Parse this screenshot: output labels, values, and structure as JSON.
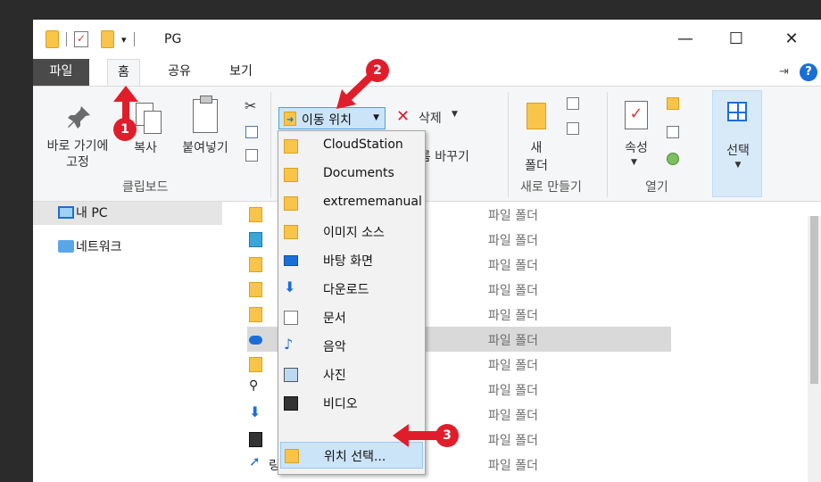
{
  "window": {
    "title": "PG"
  },
  "tabs": {
    "file": "파일",
    "home": "홈",
    "share": "공유",
    "view": "보기"
  },
  "ribbon": {
    "pin_label": "바로 가기에\n고정",
    "copy_label": "복사",
    "paste_label": "붙여넣기",
    "clipboard_group": "클립보드",
    "move_to_label": "이동 위치",
    "delete_label": "삭제",
    "rename_label": "이름 바꾸기",
    "new_folder_label_1": "새",
    "new_folder_label_2": "폴더",
    "new_group": "새로 만들기",
    "properties_label": "속성",
    "open_group": "열기",
    "select_label": "선택"
  },
  "nav": {
    "items": [
      "내 PC",
      "네트워크"
    ]
  },
  "dropdown": {
    "items": [
      "CloudStation",
      "Documents",
      "extrememanual",
      "이미지 소스",
      "바탕 화면",
      "다운로드",
      "문서",
      "음악",
      "사진",
      "비디오"
    ],
    "choose_location": "위치 선택..."
  },
  "file_list": {
    "rows": [
      {
        "name": "",
        "type": "파일 폴더"
      },
      {
        "name": "",
        "type": "파일 폴더"
      },
      {
        "name": "",
        "type": "파일 폴더"
      },
      {
        "name": "",
        "type": "파일 폴더"
      },
      {
        "name": "",
        "type": "파일 폴더"
      },
      {
        "name": "",
        "type": "파일 폴더"
      },
      {
        "name": "",
        "type": "파일 폴더"
      },
      {
        "name": "",
        "type": "파일 폴더"
      },
      {
        "name": "",
        "type": "파일 폴더"
      },
      {
        "name": "",
        "type": "파일 폴더"
      },
      {
        "name": "링크",
        "type": "파일 폴더"
      }
    ]
  },
  "annotations": {
    "step1": "1",
    "step2": "2",
    "step3": "3"
  },
  "colors": {
    "accent": "#1a6ed8",
    "highlight": "#cce4f7",
    "badge": "#e01e2b"
  }
}
